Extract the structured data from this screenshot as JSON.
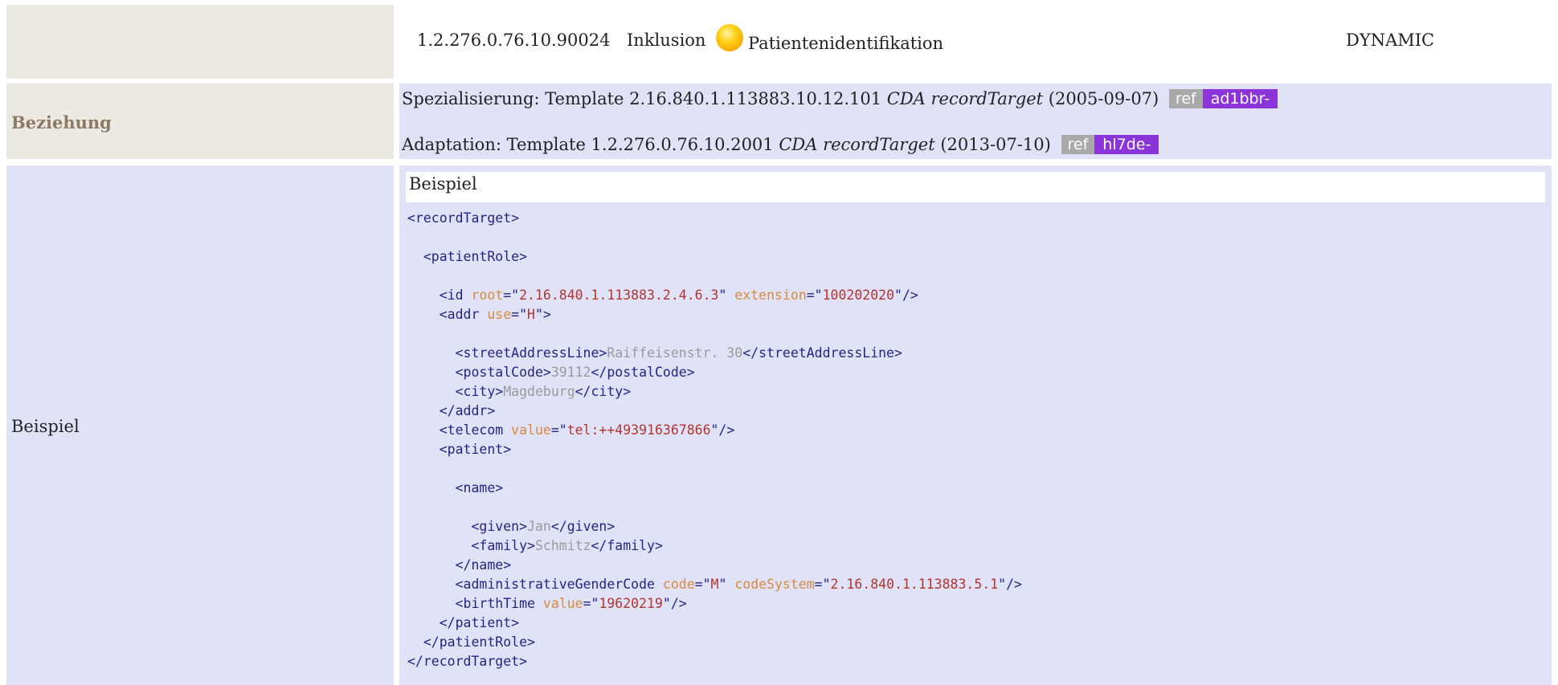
{
  "row1": {
    "oid": "1.2.276.0.76.10.90024",
    "type": "Inklusion",
    "status_icon": "yellow-circle-icon",
    "name": "Patientenidentifikation",
    "version": "DYNAMIC"
  },
  "row2": {
    "label": "Beziehung",
    "relations": [
      {
        "prefix": "Spezialisierung: Template 2.16.840.1.113883.10.12.101 ",
        "template_name": "CDA recordTarget",
        "date": " (2005-09-07)",
        "ref": "ref",
        "prefix_id": "ad1bbr-"
      },
      {
        "prefix": "Adaptation: Template 1.2.276.0.76.10.2001 ",
        "template_name": "CDA recordTarget",
        "date": " (2013-07-10)",
        "ref": "ref",
        "prefix_id": "hl7de-"
      }
    ]
  },
  "row3": {
    "label": "Beispiel",
    "example_title": "Beispiel",
    "code_lines": [
      [
        {
          "t": "tag",
          "v": "<recordTarget>"
        }
      ],
      [],
      [
        {
          "t": "tag",
          "v": "  <patientRole>"
        }
      ],
      [],
      [
        {
          "t": "tag",
          "v": "    <id "
        },
        {
          "t": "attr",
          "v": "root"
        },
        {
          "t": "tag",
          "v": "=\""
        },
        {
          "t": "val",
          "v": "2.16.840.1.113883.2.4.6.3"
        },
        {
          "t": "tag",
          "v": "\" "
        },
        {
          "t": "attr",
          "v": "extension"
        },
        {
          "t": "tag",
          "v": "=\""
        },
        {
          "t": "val",
          "v": "100202020"
        },
        {
          "t": "tag",
          "v": "\"/>"
        }
      ],
      [
        {
          "t": "tag",
          "v": "    <addr "
        },
        {
          "t": "attr",
          "v": "use"
        },
        {
          "t": "tag",
          "v": "=\""
        },
        {
          "t": "val",
          "v": "H"
        },
        {
          "t": "tag",
          "v": "\">"
        }
      ],
      [],
      [
        {
          "t": "tag",
          "v": "      <streetAddressLine>"
        },
        {
          "t": "txt",
          "v": "Raiffeisenstr. 30"
        },
        {
          "t": "tag",
          "v": "</streetAddressLine>"
        }
      ],
      [
        {
          "t": "tag",
          "v": "      <postalCode>"
        },
        {
          "t": "txt",
          "v": "39112"
        },
        {
          "t": "tag",
          "v": "</postalCode>"
        }
      ],
      [
        {
          "t": "tag",
          "v": "      <city>"
        },
        {
          "t": "txt",
          "v": "Magdeburg"
        },
        {
          "t": "tag",
          "v": "</city>"
        }
      ],
      [
        {
          "t": "tag",
          "v": "    </addr>"
        }
      ],
      [
        {
          "t": "tag",
          "v": "    <telecom "
        },
        {
          "t": "attr",
          "v": "value"
        },
        {
          "t": "tag",
          "v": "=\""
        },
        {
          "t": "val",
          "v": "tel:++493916367866"
        },
        {
          "t": "tag",
          "v": "\"/>"
        }
      ],
      [
        {
          "t": "tag",
          "v": "    <patient>"
        }
      ],
      [],
      [
        {
          "t": "tag",
          "v": "      <name>"
        }
      ],
      [],
      [
        {
          "t": "tag",
          "v": "        <given>"
        },
        {
          "t": "txt",
          "v": "Jan"
        },
        {
          "t": "tag",
          "v": "</given>"
        }
      ],
      [
        {
          "t": "tag",
          "v": "        <family>"
        },
        {
          "t": "txt",
          "v": "Schmitz"
        },
        {
          "t": "tag",
          "v": "</family>"
        }
      ],
      [
        {
          "t": "tag",
          "v": "      </name>"
        }
      ],
      [
        {
          "t": "tag",
          "v": "      <administrativeGenderCode "
        },
        {
          "t": "attr",
          "v": "code"
        },
        {
          "t": "tag",
          "v": "=\""
        },
        {
          "t": "val",
          "v": "M"
        },
        {
          "t": "tag",
          "v": "\" "
        },
        {
          "t": "attr",
          "v": "codeSystem"
        },
        {
          "t": "tag",
          "v": "=\""
        },
        {
          "t": "val",
          "v": "2.16.840.1.113883.5.1"
        },
        {
          "t": "tag",
          "v": "\"/>"
        }
      ],
      [
        {
          "t": "tag",
          "v": "      <birthTime "
        },
        {
          "t": "attr",
          "v": "value"
        },
        {
          "t": "tag",
          "v": "=\""
        },
        {
          "t": "val",
          "v": "19620219"
        },
        {
          "t": "tag",
          "v": "\"/>"
        }
      ],
      [
        {
          "t": "tag",
          "v": "    </patient>"
        }
      ],
      [
        {
          "t": "tag",
          "v": "  </patientRole>"
        }
      ],
      [
        {
          "t": "tag",
          "v": "</recordTarget>"
        }
      ]
    ]
  },
  "colors": {
    "label_beige": "#ece9e3",
    "content_blue": "#e0e3f8",
    "ref_gray": "#a9a9a9",
    "id_purple": "#8a34d9",
    "xml_tag": "#23238a",
    "xml_attr": "#d98a3c",
    "xml_value": "#b4342d",
    "xml_text": "#9a9a9a"
  }
}
